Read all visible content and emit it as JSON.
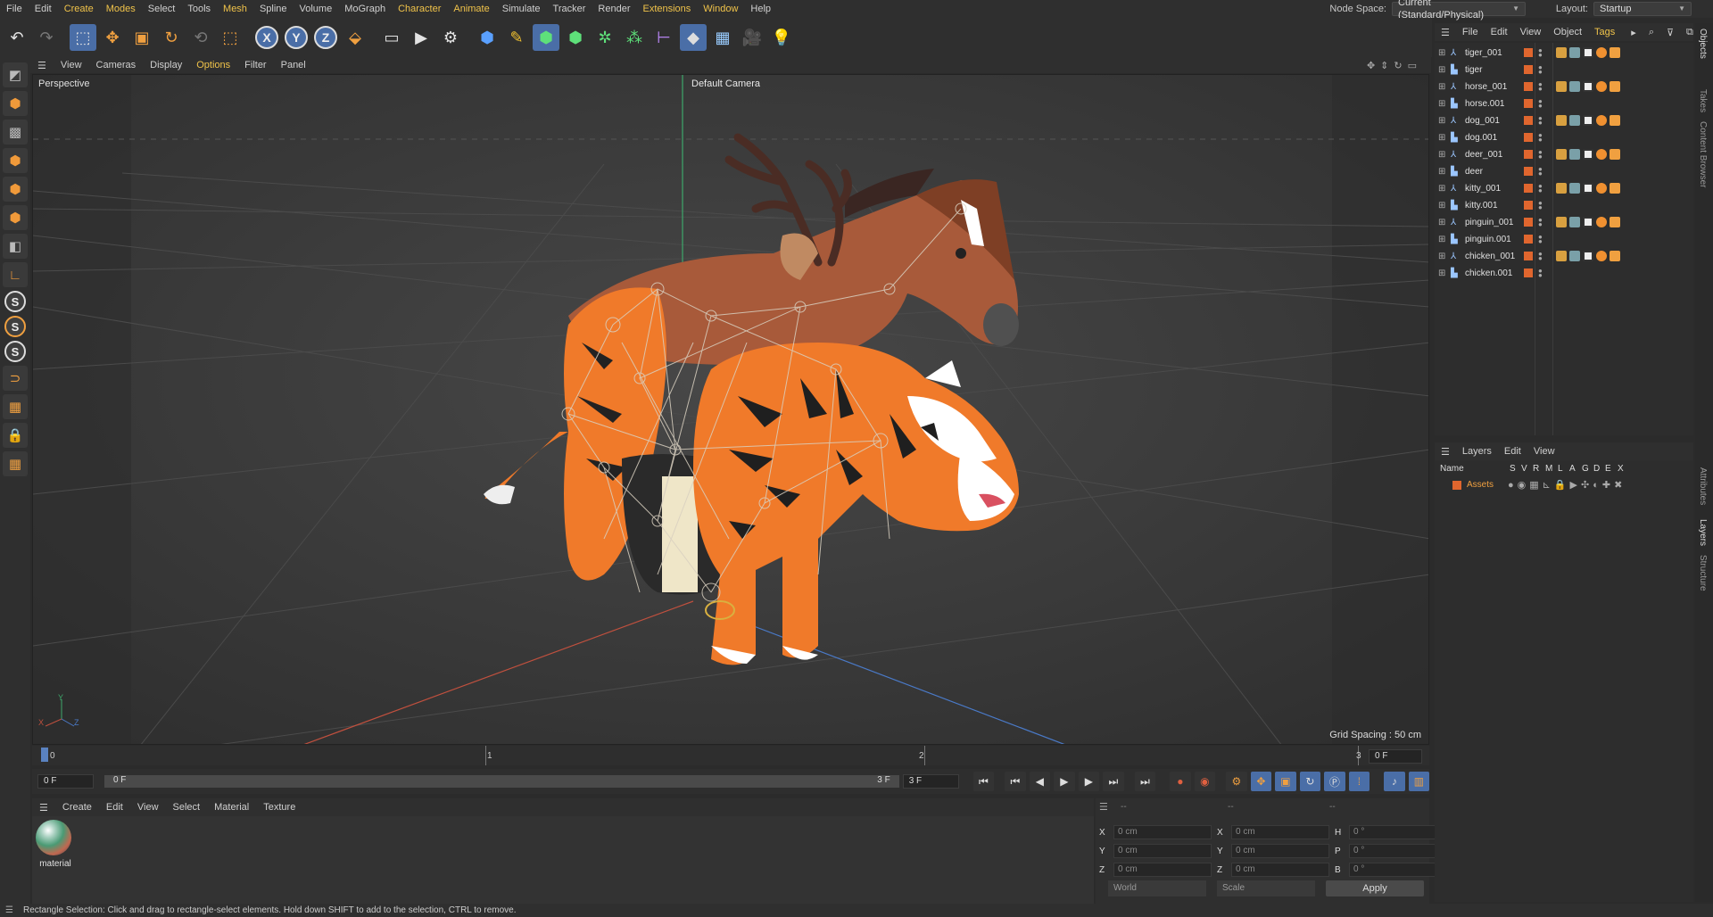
{
  "menubar": {
    "items": [
      "File",
      "Edit",
      "Create",
      "Modes",
      "Select",
      "Tools",
      "Mesh",
      "Spline",
      "Volume",
      "MoGraph",
      "Character",
      "Animate",
      "Simulate",
      "Tracker",
      "Render",
      "Extensions",
      "Window",
      "Help"
    ],
    "node_space_label": "Node Space:",
    "node_space_value": "Current (Standard/Physical)",
    "layout_label": "Layout:",
    "layout_value": "Startup"
  },
  "viewport": {
    "menu": [
      "View",
      "Cameras",
      "Display",
      "Options",
      "Filter",
      "Panel"
    ],
    "projection": "Perspective",
    "camera": "Default Camera",
    "grid_spacing": "Grid Spacing : 50 cm",
    "axis_labels": {
      "y": "Y",
      "x": "X",
      "z": "Z"
    }
  },
  "timeline": {
    "ticks": [
      "0",
      "1",
      "2",
      "3"
    ],
    "frame_end": "0 F",
    "start_field": "0 F",
    "range_left": "0 F",
    "range_right": "3 F",
    "end_field": "3 F"
  },
  "material_panel": {
    "menu": [
      "Create",
      "Edit",
      "View",
      "Select",
      "Material",
      "Texture"
    ],
    "material_name": "material"
  },
  "coordinates": {
    "header": [
      "--",
      "--",
      "--"
    ],
    "rows": [
      {
        "a": "X",
        "av": "0 cm",
        "b": "X",
        "bv": "0 cm",
        "c": "H",
        "cv": "0 °"
      },
      {
        "a": "Y",
        "av": "0 cm",
        "b": "Y",
        "bv": "0 cm",
        "c": "P",
        "cv": "0 °"
      },
      {
        "a": "Z",
        "av": "0 cm",
        "b": "Z",
        "bv": "0 cm",
        "c": "B",
        "cv": "0 °"
      }
    ],
    "space": "World",
    "mode": "Scale",
    "apply": "Apply"
  },
  "objects": {
    "menu": [
      "File",
      "Edit",
      "View",
      "Object",
      "Tags"
    ],
    "items": [
      "tiger_001",
      "tiger",
      "horse_001",
      "horse.001",
      "dog_001",
      "dog.001",
      "deer_001",
      "deer",
      "kitty_001",
      "kitty.001",
      "pinguin_001",
      "pinguin.001",
      "chicken_001",
      "chicken.001"
    ]
  },
  "layers": {
    "menu": [
      "Layers",
      "Edit",
      "View"
    ],
    "header_name": "Name",
    "header_cols": [
      "S",
      "V",
      "R",
      "M",
      "L",
      "A",
      "G",
      "D",
      "E",
      "X"
    ],
    "layer_name": "Assets"
  },
  "side_tabs": [
    "Objects",
    "Takes",
    "Content Browser",
    "Attributes",
    "Layers",
    "Structure"
  ],
  "status_text": "Rectangle Selection: Click and drag to rectangle-select elements. Hold down SHIFT to add to the selection, CTRL to remove.",
  "colors": {
    "accent": "#4a6ea7",
    "highlight_menu": "#f0c34a",
    "layer_color": "#e0662e",
    "tiger_orange": "#f07a2a"
  }
}
